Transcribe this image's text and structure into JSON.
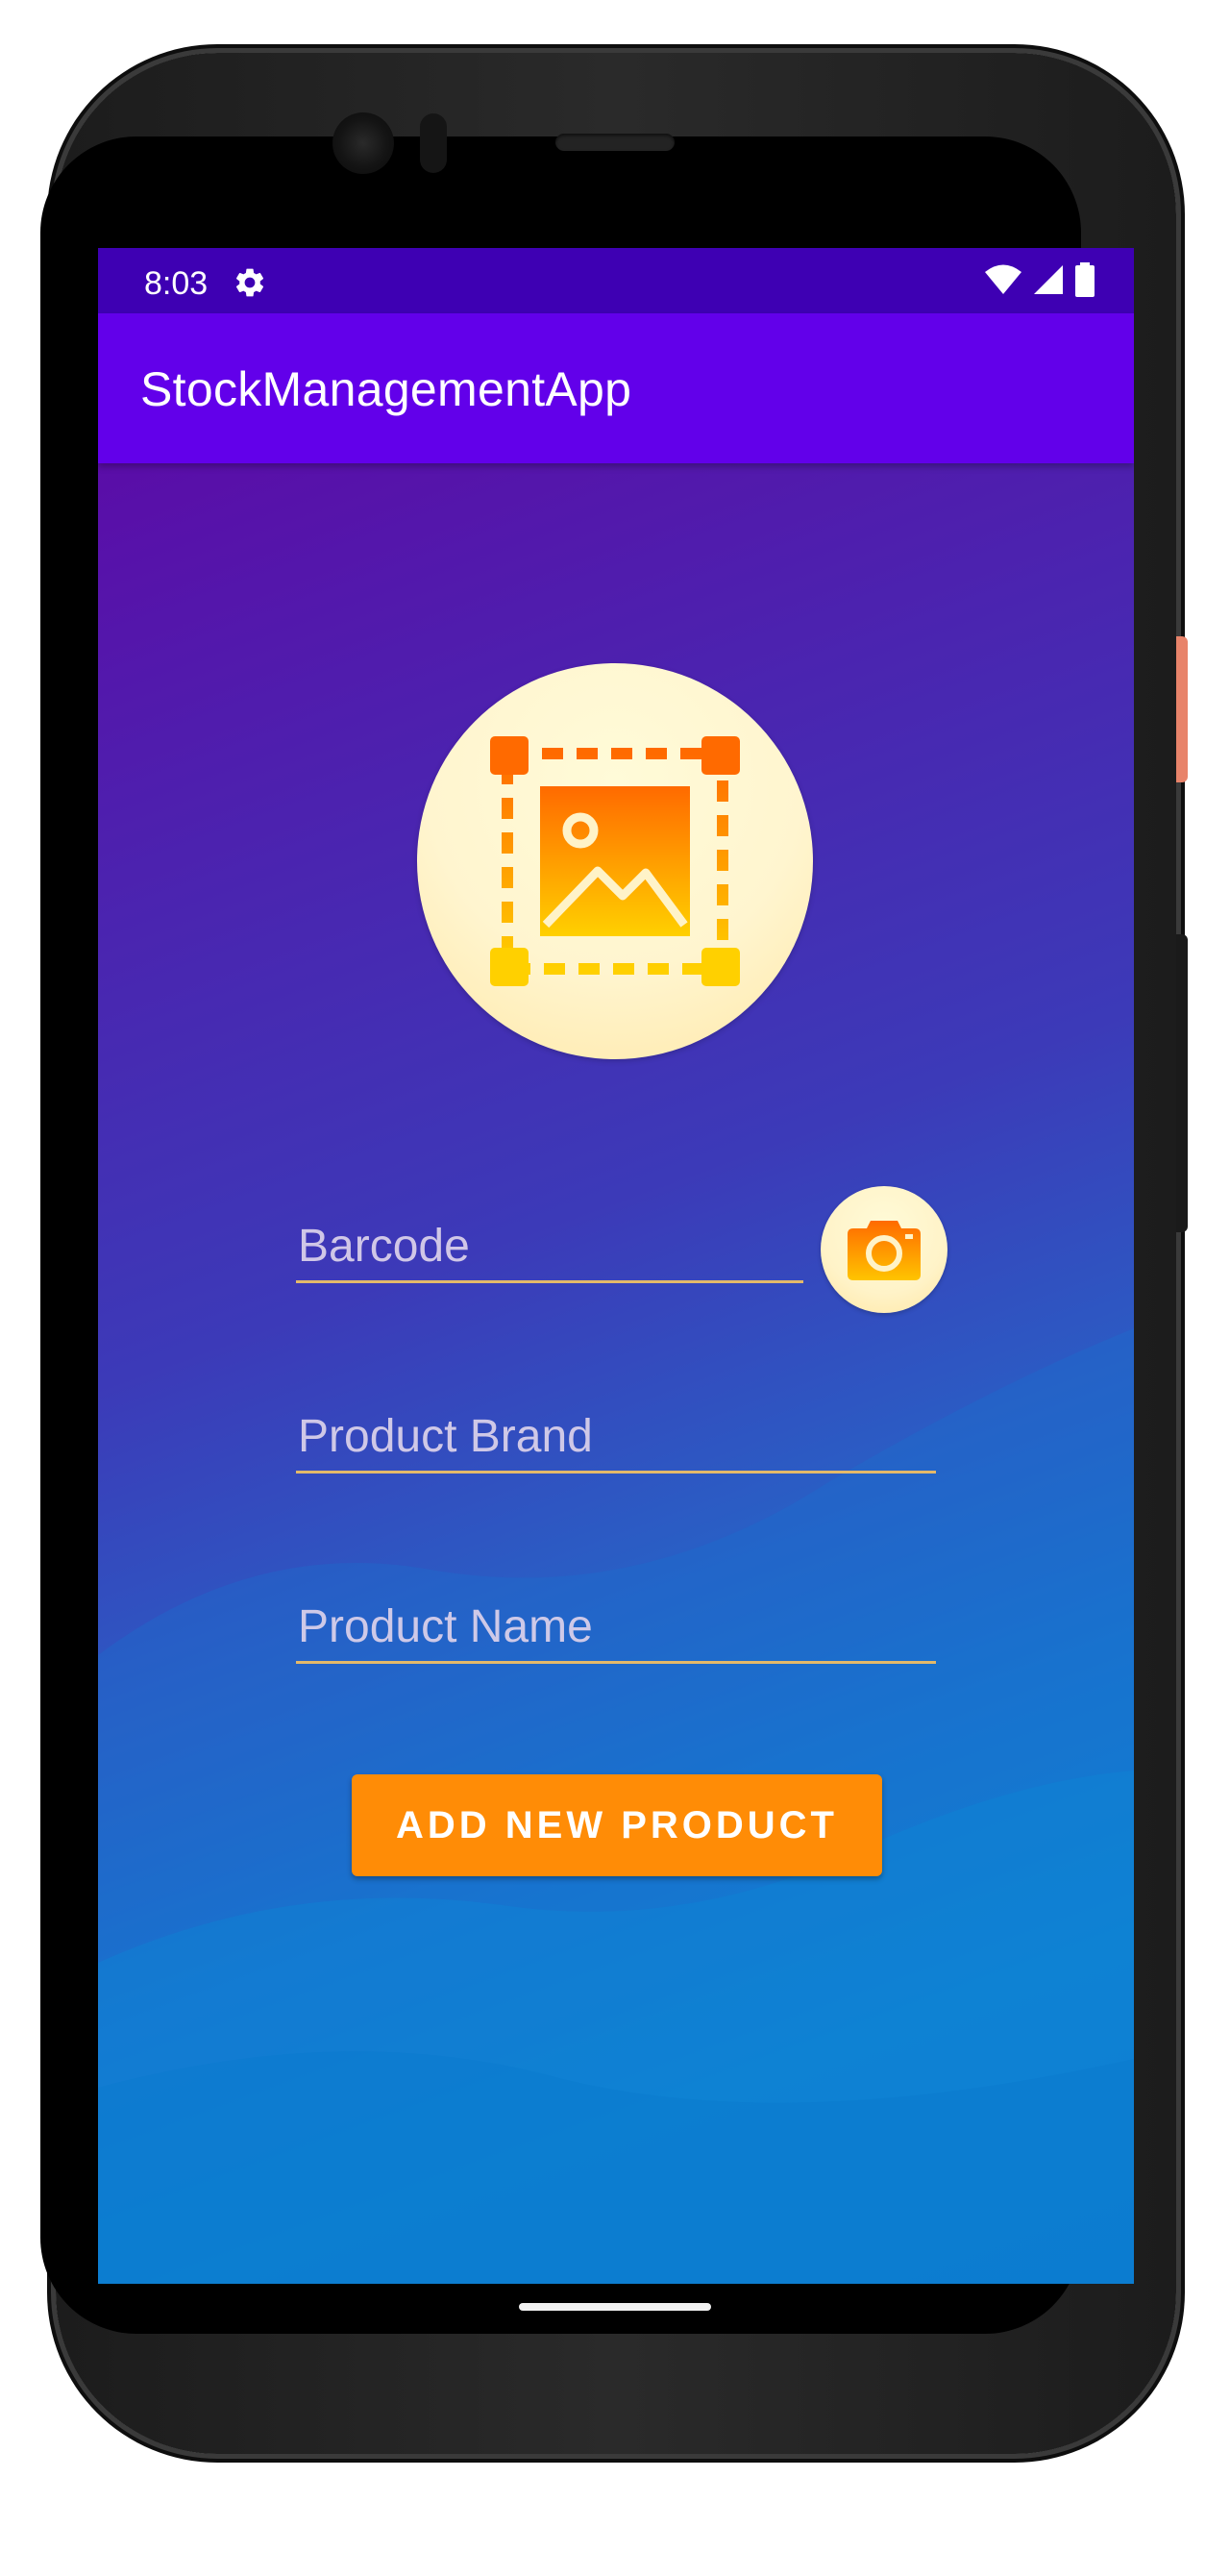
{
  "status_bar": {
    "time": "8:03",
    "icons": [
      "gear-icon",
      "wifi-icon",
      "cellular-signal-icon",
      "battery-icon"
    ]
  },
  "app_bar": {
    "title": "StockManagementApp"
  },
  "form": {
    "product_image_icon": "image-placeholder-icon",
    "barcode": {
      "value": "",
      "placeholder": "Barcode"
    },
    "scan_icon": "camera-icon",
    "product_brand": {
      "value": "",
      "placeholder": "Product Brand"
    },
    "product_name": {
      "value": "",
      "placeholder": "Product Name"
    },
    "submit_label": "ADD NEW PRODUCT"
  },
  "colors": {
    "status_bar": "#3e00b3",
    "app_bar": "#6200ea",
    "button": "#ff8c06",
    "field_underline": "#e3b96a"
  }
}
